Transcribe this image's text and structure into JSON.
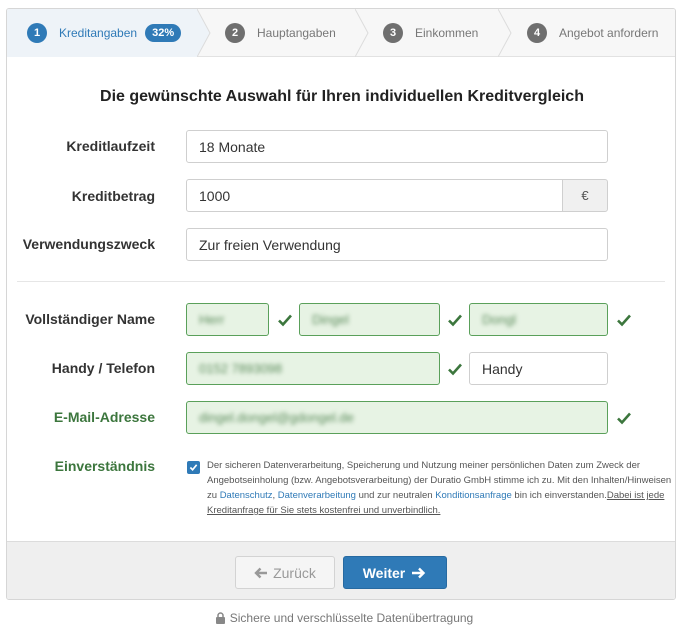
{
  "steps": [
    {
      "number": "1",
      "label": "Kreditangaben",
      "badge": "32%",
      "active": true
    },
    {
      "number": "2",
      "label": "Hauptangaben"
    },
    {
      "number": "3",
      "label": "Einkommen"
    },
    {
      "number": "4",
      "label": "Angebot anfordern"
    }
  ],
  "form": {
    "title": "Die gewünschte Auswahl für Ihren individuellen Kreditvergleich",
    "laufzeit": {
      "label": "Kreditlaufzeit",
      "value": "18 Monate"
    },
    "betrag": {
      "label": "Kreditbetrag",
      "value": "1000",
      "currency": "€"
    },
    "zweck": {
      "label": "Verwendungszweck",
      "value": "Zur freien Verwendung"
    },
    "name": {
      "label": "Vollständiger Name",
      "salutation": "Herr",
      "first_name": "Dingel",
      "last_name": "Dongl"
    },
    "phone": {
      "label": "Handy / Telefon",
      "value": "0152 7893098",
      "type": "Handy"
    },
    "email": {
      "label": "E-Mail-Adresse",
      "value": "dingel.dongel@gdongel.de"
    },
    "consent": {
      "label": "Einverständnis",
      "checked": true,
      "text_1": "Der sicheren Datenverarbeitung, Speicherung und Nutzung meiner persönlichen Daten zum Zweck der Angebotseinholung (bzw. Angebotsverarbeitung) der Duratio GmbH stimme ich zu. Mit den Inhalten/Hinweisen zu ",
      "link_1": "Datenschutz",
      "sep_1": ", ",
      "link_2": "Datenverarbeitung",
      "text_2": " und zur neutralen ",
      "link_3": "Konditionsanfrage",
      "text_3": " bin ich einverstanden.",
      "note": "Dabei ist jede Kreditanfrage für Sie stets kostenfrei und unverbindlich."
    }
  },
  "buttons": {
    "back": "Zurück",
    "next": "Weiter"
  },
  "secure_text": "Sichere und verschlüsselte Datenübertragung",
  "colors": {
    "primary": "#2f7ab7",
    "valid": "#3c763d",
    "valid_bg": "#e7f3e4"
  }
}
